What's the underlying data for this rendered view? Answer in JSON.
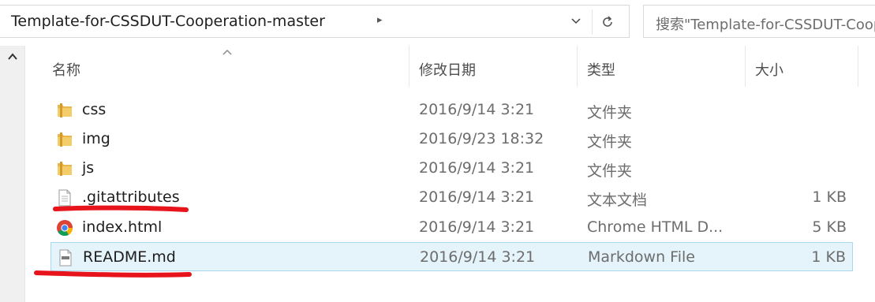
{
  "address": {
    "current_folder": "Template-for-CSSDUT-Cooperation-master",
    "chevron": "▸",
    "history_dropdown": "⌄"
  },
  "search": {
    "placeholder": "搜索\"Template-for-CSSDUT-Cooperation-master\""
  },
  "columns": {
    "name": "名称",
    "date": "修改日期",
    "type": "类型",
    "size": "大小"
  },
  "files": [
    {
      "name": "css",
      "date": "2016/9/14 3:21",
      "type": "文件夹",
      "size": "",
      "icon": "folder-icon"
    },
    {
      "name": "img",
      "date": "2016/9/23 18:32",
      "type": "文件夹",
      "size": "",
      "icon": "folder-icon"
    },
    {
      "name": "js",
      "date": "2016/9/14 3:21",
      "type": "文件夹",
      "size": "",
      "icon": "folder-icon"
    },
    {
      "name": ".gitattributes",
      "date": "2016/9/14 3:21",
      "type": "文本文档",
      "size": "1 KB",
      "icon": "text-file-icon"
    },
    {
      "name": "index.html",
      "date": "2016/9/14 3:21",
      "type": "Chrome HTML D...",
      "size": "5 KB",
      "icon": "chrome-icon"
    },
    {
      "name": "README.md",
      "date": "2016/9/14 3:21",
      "type": "Markdown File",
      "size": "1 KB",
      "icon": "markdown-file-icon",
      "selected": true
    }
  ],
  "colors": {
    "selection_bg": "#e5f3fb",
    "selection_border": "#a9d7f0",
    "annotation_red": "#e8141c",
    "folder_yellow": "#e8b64a"
  }
}
